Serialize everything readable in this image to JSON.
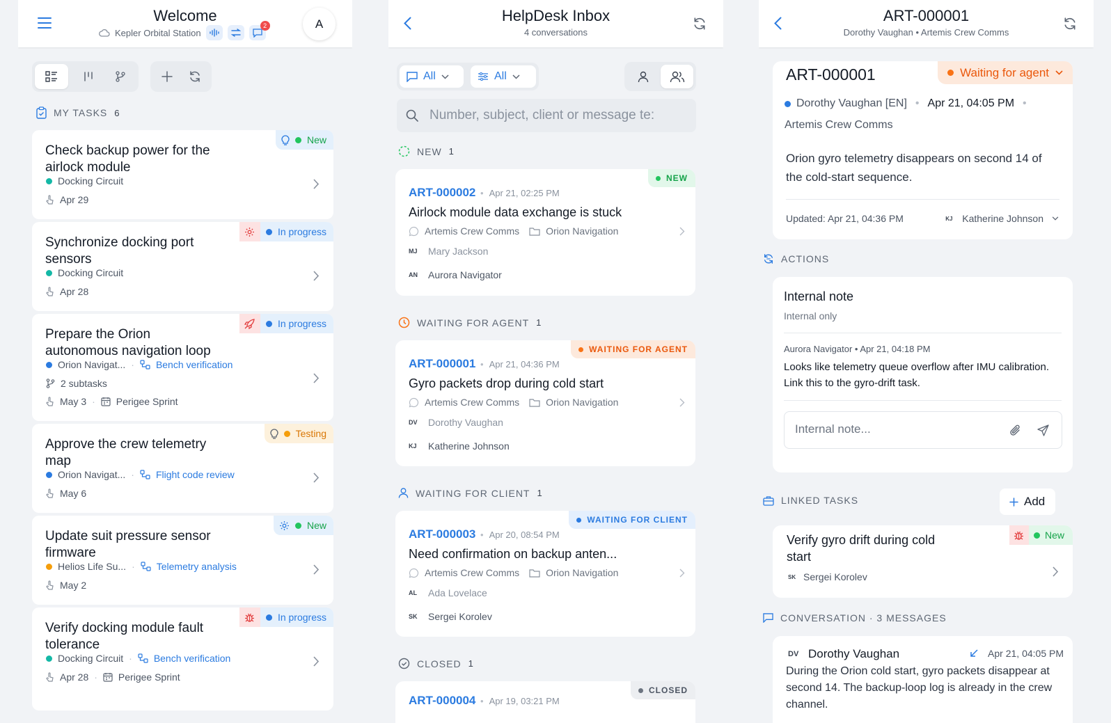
{
  "welcome": {
    "title": "Welcome",
    "station": "Kepler Orbital Station",
    "chat_count": "2",
    "avatar": "A",
    "section_label": "MY TASKS",
    "section_count": "6",
    "tasks": [
      {
        "title": "Check backup power for the airlock module",
        "status": "New",
        "project": "Docking Circuit",
        "date": "Apr 29"
      },
      {
        "title": "Synchronize docking port sensors",
        "status": "In progress",
        "project": "Docking Circuit",
        "date": "Apr 28"
      },
      {
        "title": "Prepare the Orion autonomous navigation loop",
        "status": "In progress",
        "project": "Orion Navigat...",
        "stage": "Bench verification",
        "subtasks": "2 subtasks",
        "date": "May 3",
        "sprint": "Perigee Sprint"
      },
      {
        "title": "Approve the crew telemetry map",
        "status": "Testing",
        "project": "Orion Navigat...",
        "stage": "Flight code review",
        "date": "May 6"
      },
      {
        "title": "Update suit pressure sensor firmware",
        "status": "New",
        "project": "Helios Life Su...",
        "stage": "Telemetry analysis",
        "date": "May 2"
      },
      {
        "title": "Verify docking module fault tolerance",
        "status": "In progress",
        "project": "Docking Circuit",
        "stage": "Bench verification",
        "date": "Apr 28",
        "sprint": "Perigee Sprint"
      }
    ]
  },
  "inbox": {
    "title": "HelpDesk Inbox",
    "subtitle": "4 conversations",
    "filter1": "All",
    "filter2": "All",
    "search_placeholder": "Number, subject, client or message te:",
    "groups": [
      {
        "label": "NEW",
        "count": "1"
      },
      {
        "label": "WAITING FOR AGENT",
        "count": "1"
      },
      {
        "label": "WAITING FOR CLIENT",
        "count": "1"
      },
      {
        "label": "CLOSED",
        "count": "1"
      }
    ],
    "tickets": [
      {
        "number": "ART-000002",
        "date": "Apr 21, 02:25 PM",
        "subject": "Airlock module data exchange is stuck",
        "channel": "Artemis Crew Comms",
        "project": "Orion Navigation",
        "client_initials": "MJ",
        "client": "Mary Jackson",
        "agent_initials": "AN",
        "agent": "Aurora Navigator",
        "badge": "NEW"
      },
      {
        "number": "ART-000001",
        "date": "Apr 21, 04:36 PM",
        "subject": "Gyro packets drop during cold start",
        "channel": "Artemis Crew Comms",
        "project": "Orion Navigation",
        "client_initials": "DV",
        "client": "Dorothy Vaughan",
        "agent_initials": "KJ",
        "agent": "Katherine Johnson",
        "badge": "WAITING FOR AGENT"
      },
      {
        "number": "ART-000003",
        "date": "Apr 20, 08:54 PM",
        "subject": "Need confirmation on backup anten...",
        "channel": "Artemis Crew Comms",
        "project": "Orion Navigation",
        "client_initials": "AL",
        "client": "Ada Lovelace",
        "agent_initials": "SK",
        "agent": "Sergei Korolev",
        "badge": "WAITING FOR CLIENT"
      },
      {
        "number": "ART-000004",
        "date": "Apr 19, 03:21 PM",
        "badge": "CLOSED"
      }
    ]
  },
  "detail": {
    "title": "ART-000001",
    "subtitle": "Dorothy Vaughan • Artemis Crew Comms",
    "ticket_number": "ART-000001",
    "status": "Waiting for agent",
    "client": "Dorothy Vaughan [EN]",
    "created": "Apr 21, 04:05 PM",
    "channel": "Artemis Crew Comms",
    "description": "Orion gyro telemetry disappears on second 14 of the cold-start sequence.",
    "updated": "Updated: Apr 21, 04:36 PM",
    "assignee_initials": "KJ",
    "assignee": "Katherine Johnson",
    "actions_label": "ACTIONS",
    "note_title": "Internal note",
    "note_sub": "Internal only",
    "note_meta": "Aurora Navigator • Apr 21, 04:18 PM",
    "note_text": "Looks like telemetry queue overflow after IMU calibration. Link this to the gyro-drift task.",
    "note_placeholder": "Internal note...",
    "linked_label": "LINKED TASKS",
    "add_label": "Add",
    "linked_task": {
      "title": "Verify gyro drift during cold start",
      "status": "New",
      "assignee_initials": "SK",
      "assignee": "Sergei Korolev"
    },
    "conv_label": "CONVERSATION · 3 MESSAGES",
    "message": {
      "initials": "DV",
      "author": "Dorothy Vaughan",
      "date": "Apr 21, 04:05 PM",
      "text": "During the Orion cold start, gyro packets disappear at second 14. The backup-loop log is already in the crew channel."
    }
  },
  "colors": {
    "accent": "#2b7be0",
    "new": "#22c55e",
    "progress": "#2b7be0",
    "testing": "#f59e0b",
    "waiting": "#f97316",
    "teal": "#14b8a6"
  }
}
